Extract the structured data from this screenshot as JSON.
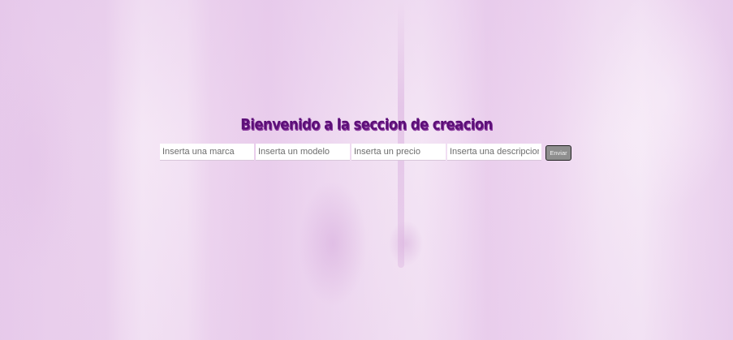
{
  "page": {
    "title": "Bienvenido a la seccion de creacion"
  },
  "form": {
    "brand_placeholder": "Inserta una marca",
    "model_placeholder": "Inserta un modelo",
    "price_placeholder": "Inserta un precio",
    "description_placeholder": "Inserta una descripcion",
    "submit_label": "Enviar"
  },
  "colors": {
    "title": "#5c0f78",
    "background": "#ecd6ee",
    "button": "#8e8e8e"
  }
}
